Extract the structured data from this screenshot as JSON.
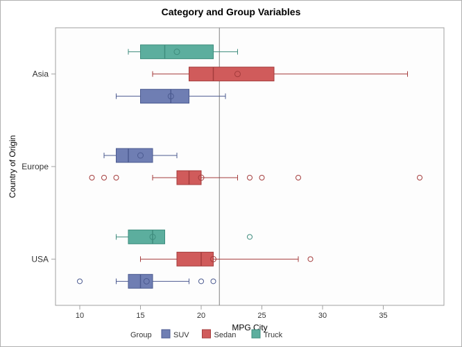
{
  "chart_data": {
    "type": "boxplot-horizontal",
    "title": "Category and Group Variables",
    "xlabel": "MPG City",
    "ylabel": "Country of Origin",
    "categories": [
      "Asia",
      "Europe",
      "USA"
    ],
    "group_label": "Group",
    "groups": [
      {
        "name": "SUV",
        "color": "#6F7EB3",
        "stroke": "#4B5A90"
      },
      {
        "name": "Sedan",
        "color": "#D05B5B",
        "stroke": "#A43C3C"
      },
      {
        "name": "Truck",
        "color": "#5CAE9E",
        "stroke": "#3E8C7D"
      }
    ],
    "series": [
      {
        "category": "Asia",
        "group": "Truck",
        "min": 14,
        "q1": 15,
        "median": 17,
        "q3": 21,
        "max": 23,
        "mean": 18,
        "outliers": []
      },
      {
        "category": "Asia",
        "group": "Sedan",
        "min": 16,
        "q1": 19,
        "median": 21,
        "q3": 26,
        "max": 37,
        "mean": 23,
        "outliers": []
      },
      {
        "category": "Asia",
        "group": "SUV",
        "min": 13,
        "q1": 15,
        "median": 17.5,
        "q3": 19,
        "max": 22,
        "mean": 17.5,
        "outliers": []
      },
      {
        "category": "Europe",
        "group": "SUV",
        "min": 12,
        "q1": 13,
        "median": 14,
        "q3": 16,
        "max": 18,
        "mean": 15,
        "outliers": []
      },
      {
        "category": "Europe",
        "group": "Sedan",
        "min": 16,
        "q1": 18,
        "median": 19,
        "q3": 20,
        "max": 23,
        "mean": 20,
        "outliers": [
          11,
          12,
          13,
          24,
          25,
          28,
          38
        ]
      },
      {
        "category": "USA",
        "group": "Truck",
        "min": 13,
        "q1": 14,
        "median": 16,
        "q3": 17,
        "max": 17,
        "mean": 16,
        "outliers": [
          24
        ]
      },
      {
        "category": "USA",
        "group": "Sedan",
        "min": 15,
        "q1": 18,
        "median": 20,
        "q3": 21,
        "max": 28,
        "mean": 21,
        "outliers": [
          29
        ]
      },
      {
        "category": "USA",
        "group": "SUV",
        "min": 13,
        "q1": 14,
        "median": 15,
        "q3": 16,
        "max": 19,
        "mean": 15.5,
        "outliers": [
          10,
          20,
          21
        ]
      }
    ],
    "x_ticks": [
      10,
      15,
      20,
      25,
      30,
      35
    ],
    "xlim": [
      8,
      40
    ],
    "refline_x": 21.5
  }
}
